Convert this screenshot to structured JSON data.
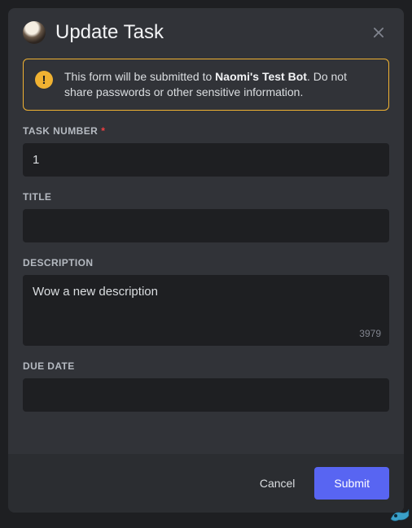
{
  "header": {
    "title": "Update Task"
  },
  "warning": {
    "prefix": "This form will be submitted to ",
    "bot_name": "Naomi's Test Bot",
    "suffix": ". Do not share passwords or other sensitive information."
  },
  "fields": {
    "task_number": {
      "label": "TASK NUMBER",
      "value": "1",
      "required": true
    },
    "title": {
      "label": "TITLE",
      "value": ""
    },
    "description": {
      "label": "DESCRIPTION",
      "value": "Wow a new description",
      "remaining": "3979"
    },
    "due_date": {
      "label": "DUE DATE",
      "value": ""
    }
  },
  "footer": {
    "cancel": "Cancel",
    "submit": "Submit"
  }
}
